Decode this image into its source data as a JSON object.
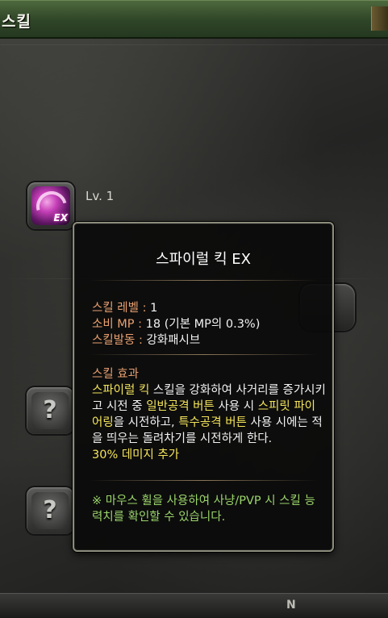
{
  "window": {
    "title": "스킬"
  },
  "skill_slot": {
    "level": "Lv. 1",
    "icon_badge": "EX",
    "icon": "spiral-kick-icon"
  },
  "locked_slot_glyph": "?",
  "tooltip": {
    "name": "스파이럴 킥 EX",
    "stats": [
      {
        "label": "스킬 레벨 : ",
        "value": "1"
      },
      {
        "label": "소비 MP : ",
        "value": "18 (기본 MP의 0.3%)"
      },
      {
        "label": "스킬발동 : ",
        "value": "강화패시브"
      }
    ],
    "effect_title": "스킬 효과",
    "effect_segments": [
      {
        "text": "스파이럴 킥",
        "highlight": true
      },
      {
        "text": " 스킬을 강화하여 사거리를 증가시키고 시전 중 ",
        "highlight": false
      },
      {
        "text": "일반공격 버튼",
        "highlight": true
      },
      {
        "text": " 사용 시 ",
        "highlight": false
      },
      {
        "text": "스피릿 파이어링",
        "highlight": true
      },
      {
        "text": "을 시전하고, ",
        "highlight": false
      },
      {
        "text": "특수공격 버튼",
        "highlight": true
      },
      {
        "text": " 사용 시에는 적을 띄우는 돌려차기를 시전하게 한다.",
        "highlight": false
      }
    ],
    "effect_extra": "30% 데미지 추가",
    "note": "※ 마우스 휠을 사용하여 사냥/PVP 시 스킬 능력치를 확인할 수 있습니다."
  },
  "bottom_bar_glyph": "N",
  "colors": {
    "label": "#e8a070",
    "highlight": "#f4e45a",
    "note": "#9ad46a",
    "titlebar": "#2f4527"
  }
}
